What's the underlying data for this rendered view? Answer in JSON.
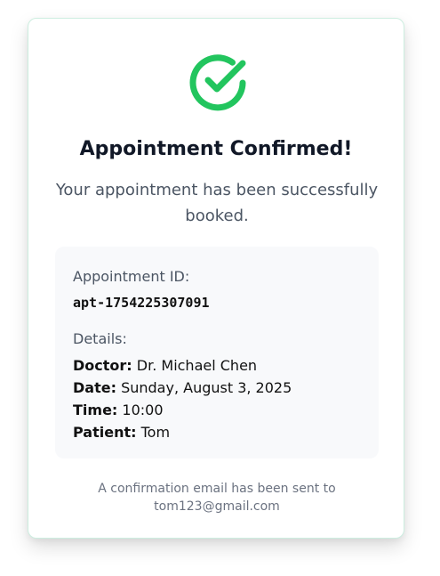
{
  "confirmation": {
    "icon": "check-circle-icon",
    "accent_color": "#22c55e",
    "title": "Appointment Confirmed!",
    "subtitle": "Your appointment has been successfully booked."
  },
  "appointment": {
    "id_label": "Appointment ID:",
    "id_value": "apt-1754225307091",
    "details_label": "Details:",
    "details": [
      {
        "label": "Doctor:",
        "value": "Dr. Michael Chen"
      },
      {
        "label": "Date:",
        "value": "Sunday, August 3, 2025"
      },
      {
        "label": "Time:",
        "value": "10:00"
      },
      {
        "label": "Patient:",
        "value": "Tom"
      }
    ]
  },
  "footer": {
    "line1": "A confirmation email has been sent to",
    "email": "tom123@gmail.com"
  }
}
